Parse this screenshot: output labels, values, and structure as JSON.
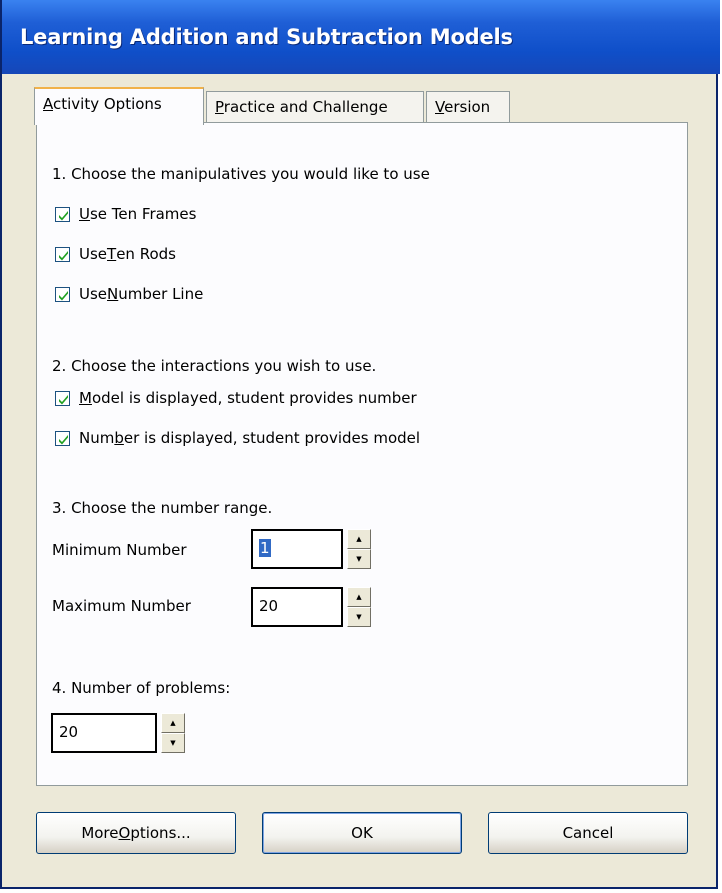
{
  "window": {
    "title": "Learning Addition and Subtraction Models"
  },
  "tabs": [
    {
      "pre": "",
      "u": "A",
      "post": "ctivity Options",
      "active": true
    },
    {
      "pre": "",
      "u": "P",
      "post": "ractice and Challenge",
      "active": false
    },
    {
      "pre": "",
      "u": "V",
      "post": "ersion",
      "active": false
    }
  ],
  "section1": {
    "heading": "1. Choose the manipulatives you would like to use",
    "options": [
      {
        "pre": "",
        "u": "U",
        "post": "se Ten Frames",
        "checked": true
      },
      {
        "pre": "Use ",
        "u": "T",
        "post": "en Rods",
        "checked": true
      },
      {
        "pre": "Use ",
        "u": "N",
        "post": "umber Line",
        "checked": true
      }
    ]
  },
  "section2": {
    "heading": "2.  Choose the interactions you wish to use.",
    "options": [
      {
        "pre": "",
        "u": "M",
        "post": "odel is displayed, student provides number",
        "checked": true
      },
      {
        "pre": "Num",
        "u": "b",
        "post": "er is displayed, student provides model",
        "checked": true
      }
    ]
  },
  "section3": {
    "heading": "3. Choose the number range.",
    "min_label": "Minimum Number",
    "min_value": "1",
    "max_label": "Maximum Number",
    "max_value": "20"
  },
  "section4": {
    "heading": "4. Number of problems:",
    "value": "20"
  },
  "buttons": {
    "more_pre": "More ",
    "more_u": "O",
    "more_post": "ptions...",
    "ok": "OK",
    "cancel": "Cancel"
  },
  "spin_up_glyph": "▲",
  "spin_down_glyph": "▼"
}
